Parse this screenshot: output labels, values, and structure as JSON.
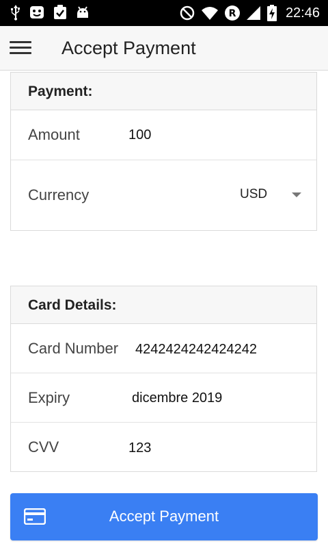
{
  "status_bar": {
    "time": "22:46",
    "left_icons": [
      "usb-icon",
      "notification-icon",
      "clipboard-check-icon",
      "android-debug-icon"
    ],
    "right_icons": [
      "do-not-disturb-icon",
      "wifi-icon",
      "roaming-icon",
      "signal-icon",
      "battery-charging-icon"
    ]
  },
  "appbar": {
    "title": "Accept Payment",
    "menu_icon": "hamburger-icon"
  },
  "payment": {
    "header": "Payment:",
    "amount_label": "Amount",
    "amount_value": "100",
    "currency_label": "Currency",
    "currency_value": "USD"
  },
  "card_details": {
    "header": "Card Details:",
    "number_label": "Card Number",
    "number_value": "4242424242424242",
    "expiry_label": "Expiry",
    "expiry_value": "dicembre 2019",
    "cvv_label": "CVV",
    "cvv_value": "123"
  },
  "button": {
    "label": "Accept Payment",
    "icon": "credit-card-icon"
  },
  "colors": {
    "accent": "#3a7ff3",
    "status_bar": "#000000",
    "appbar": "#f7f7f7"
  }
}
